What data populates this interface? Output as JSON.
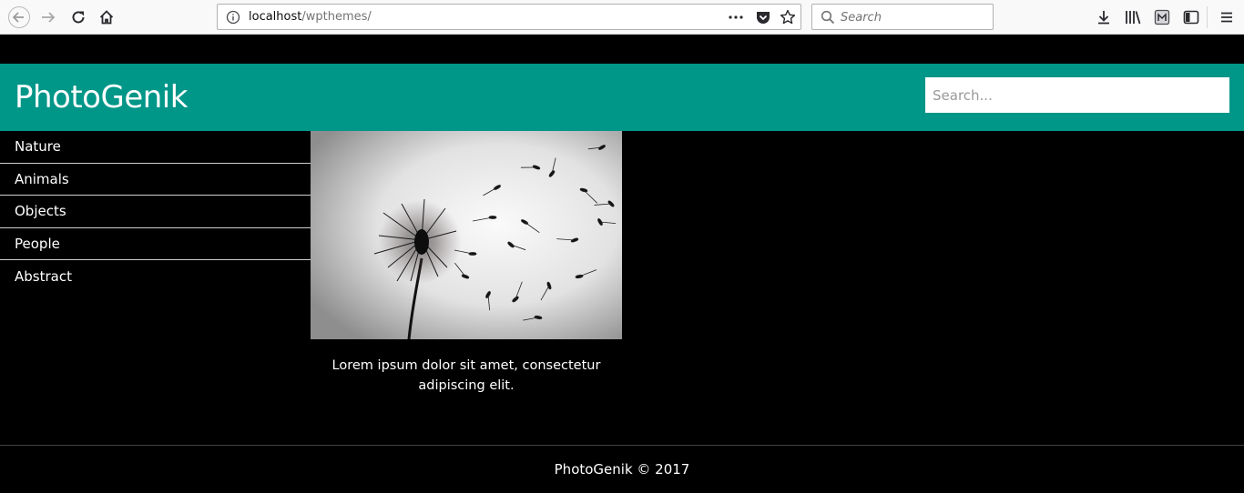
{
  "browser": {
    "url_host": "localhost",
    "url_path": "/wpthemes/",
    "search_placeholder": "Search"
  },
  "site": {
    "title": "PhotoGenik",
    "search_placeholder": "Search..."
  },
  "nav": {
    "items": [
      {
        "label": "Nature"
      },
      {
        "label": "Animals"
      },
      {
        "label": "Objects"
      },
      {
        "label": "People"
      },
      {
        "label": "Abstract"
      }
    ]
  },
  "post": {
    "image": "dandelion-photo",
    "caption": "Lorem ipsum dolor sit amet, consectetur adipiscing elit."
  },
  "footer": {
    "text": "PhotoGenik © 2017"
  },
  "colors": {
    "header": "#009688",
    "background": "#000000",
    "text": "#ffffff"
  }
}
